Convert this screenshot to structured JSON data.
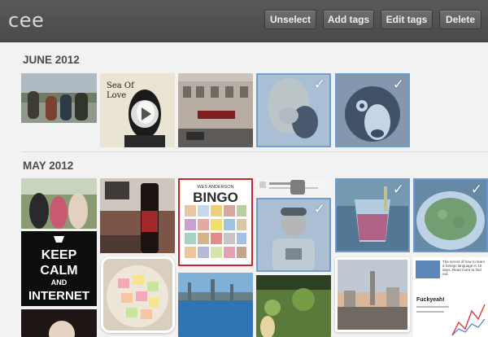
{
  "app": {
    "title": "cee"
  },
  "toolbar": {
    "unselect_label": "Unselect",
    "add_tags_label": "Add tags",
    "edit_tags_label": "Edit tags",
    "delete_label": "Delete"
  },
  "sections": [
    {
      "label": "JUNE 2012"
    },
    {
      "label": "MAY 2012"
    }
  ],
  "photos": {
    "keep_calm_lines": [
      "KEEP",
      "CALM",
      "AND",
      "INTERNET"
    ],
    "bingo_title": "WES ANDERSON",
    "bingo_word": "BINGO",
    "article_title": "Fuckyeah!",
    "article_text": "The secret of how to learn a foreign language in 10 days. Read more to find out."
  },
  "colors": {
    "topbar": "#4f4f4f",
    "selection": "#7aa5d5",
    "background": "#f2f2f2"
  },
  "icons": [
    "checkmark-icon",
    "play-icon"
  ]
}
